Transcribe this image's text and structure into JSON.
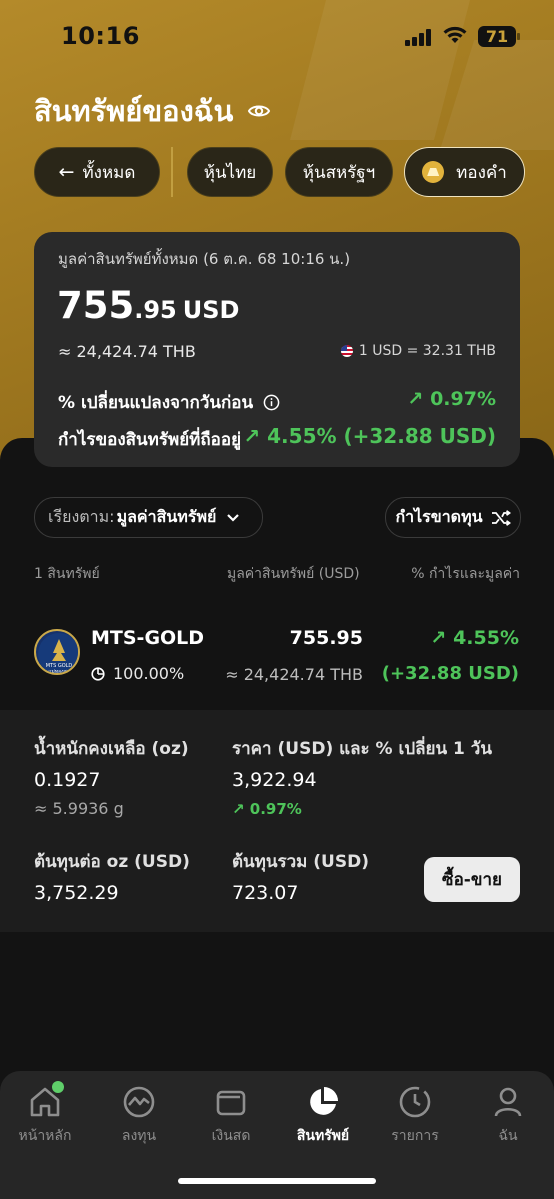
{
  "status": {
    "time": "10:16",
    "battery": "71"
  },
  "header": {
    "title": "สินทรัพย์ของฉัน"
  },
  "filters": {
    "back": "ทั้งหมด",
    "thai": "หุ้นไทย",
    "us": "หุ้นสหรัฐฯ",
    "gold": "ทองคำ"
  },
  "summary": {
    "label": "มูลค่าสินทรัพย์ทั้งหมด",
    "date": "(6 ต.ค. 68 10:16 น.)",
    "amount_int": "755",
    "amount_dec": ".95",
    "currency": "USD",
    "thb": "≈ 24,424.74 THB",
    "fx": "1 USD = 32.31 THB",
    "daily_change_label": "% เปลี่ยนแปลงจากวันก่อน",
    "daily_change_value": "↗ 0.97%",
    "holding_pl_label": "กำไรของสินทรัพย์ที่ถืออยู่",
    "holding_pl_value": "↗ 4.55% (+32.88 USD)"
  },
  "controls": {
    "sort_prefix": "เรียงตาม:",
    "sort_value": "มูลค่าสินทรัพย์",
    "pl_toggle": "กำไรขาดทุน"
  },
  "columns": {
    "count": "1 สินทรัพย์",
    "value": "มูลค่าสินทรัพย์ (USD)",
    "pl": "% กำไรและมูลค่า"
  },
  "asset": {
    "name": "MTS-GOLD",
    "share": "100.00%",
    "value_usd": "755.95",
    "value_thb": "≈ 24,424.74 THB",
    "pl_pct": "↗ 4.55%",
    "pl_usd": "(+32.88 USD)",
    "logo_text": "MTS GOLD",
    "logo_sub": "แม่ทองสุก"
  },
  "details": {
    "weight_label": "น้ำหนักคงเหลือ (oz)",
    "weight_value": "0.1927",
    "weight_g": "≈ 5.9936 g",
    "price_label": "ราคา (USD) และ % เปลี่ยน 1 วัน",
    "price_value": "3,922.94",
    "price_change": "↗ 0.97%",
    "cost_oz_label": "ต้นทุนต่อ oz (USD)",
    "cost_oz_value": "3,752.29",
    "cost_total_label": "ต้นทุนรวม (USD)",
    "cost_total_value": "723.07",
    "trade_button": "ซื้อ-ขาย"
  },
  "tabs": [
    {
      "label": "หน้าหลัก",
      "icon": "home-icon"
    },
    {
      "label": "ลงทุน",
      "icon": "chart-icon"
    },
    {
      "label": "เงินสด",
      "icon": "wallet-icon"
    },
    {
      "label": "สินทรัพย์",
      "icon": "pie-icon"
    },
    {
      "label": "รายการ",
      "icon": "clock-icon"
    },
    {
      "label": "ฉัน",
      "icon": "user-icon"
    }
  ],
  "colors": {
    "gold": "#a57d22",
    "green": "#4ec45a",
    "card": "#2a2a2a",
    "bg": "#131313"
  }
}
